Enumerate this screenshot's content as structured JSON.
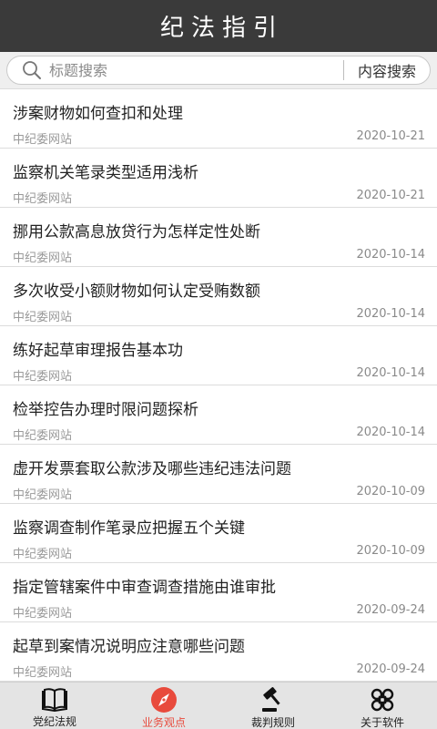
{
  "header": {
    "title": "纪法指引"
  },
  "search": {
    "placeholder": "标题搜索",
    "value": "",
    "content_search_label": "内容搜索"
  },
  "articles": [
    {
      "title": "涉案财物如何查扣和处理",
      "source": "中纪委网站",
      "date": "2020-10-21"
    },
    {
      "title": "监察机关笔录类型适用浅析",
      "source": "中纪委网站",
      "date": "2020-10-21"
    },
    {
      "title": "挪用公款高息放贷行为怎样定性处断",
      "source": "中纪委网站",
      "date": "2020-10-14"
    },
    {
      "title": "多次收受小额财物如何认定受贿数额",
      "source": "中纪委网站",
      "date": "2020-10-14"
    },
    {
      "title": "练好起草审理报告基本功",
      "source": "中纪委网站",
      "date": "2020-10-14"
    },
    {
      "title": "检举控告办理时限问题探析",
      "source": "中纪委网站",
      "date": "2020-10-14"
    },
    {
      "title": "虚开发票套取公款涉及哪些违纪违法问题",
      "source": "中纪委网站",
      "date": "2020-10-09"
    },
    {
      "title": "监察调查制作笔录应把握五个关键",
      "source": "中纪委网站",
      "date": "2020-10-09"
    },
    {
      "title": "指定管辖案件中审查调查措施由谁审批",
      "source": "中纪委网站",
      "date": "2020-09-24"
    },
    {
      "title": "起草到案情况说明应注意哪些问题",
      "source": "中纪委网站",
      "date": "2020-09-24"
    }
  ],
  "tabs": [
    {
      "label": "党纪法规",
      "icon": "book-icon",
      "active": false
    },
    {
      "label": "业务观点",
      "icon": "compass-icon",
      "active": true
    },
    {
      "label": "裁判规则",
      "icon": "gavel-icon",
      "active": false
    },
    {
      "label": "关于软件",
      "icon": "command-icon",
      "active": false
    }
  ],
  "colors": {
    "header_bg": "#3a3a3a",
    "active_tab": "#e84a3c",
    "tabbar_bg": "#e4e4e4",
    "muted_text": "#9a9a9a"
  }
}
